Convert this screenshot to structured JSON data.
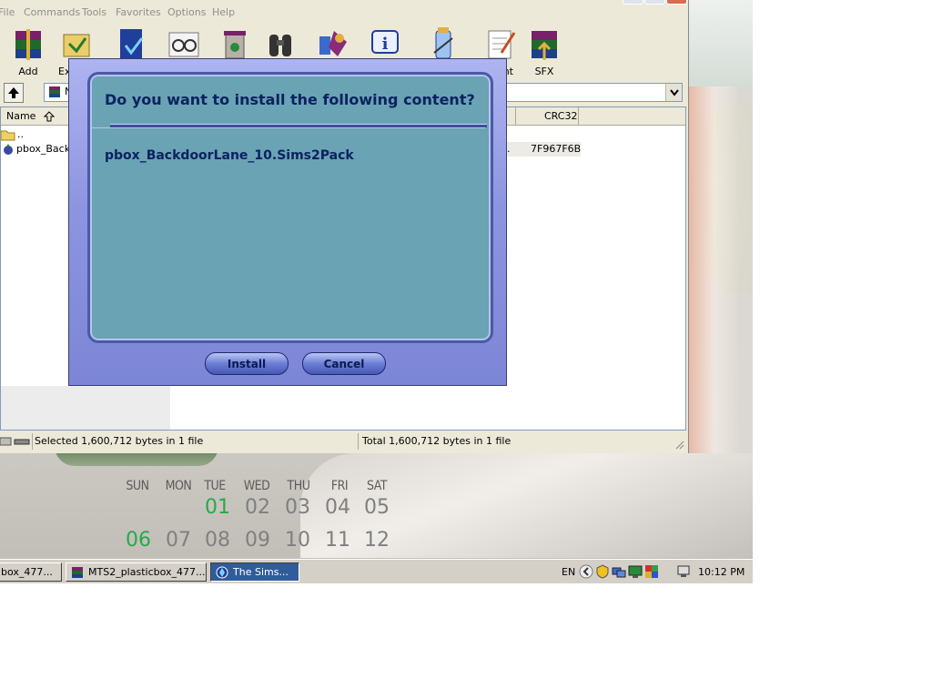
{
  "winrar": {
    "menu": [
      "File",
      "Commands",
      "Tools",
      "Favorites",
      "Options",
      "Help"
    ],
    "toolbar": [
      {
        "label": "Add",
        "icon": "archive-add-icon"
      },
      {
        "label": "Ex",
        "icon": "extract-icon"
      },
      {
        "label": "",
        "icon": "test-icon"
      },
      {
        "label": "",
        "icon": "view-icon"
      },
      {
        "label": "",
        "icon": "delete-icon"
      },
      {
        "label": "",
        "icon": "find-icon"
      },
      {
        "label": "",
        "icon": "wizard-icon"
      },
      {
        "label": "",
        "icon": "info-icon"
      },
      {
        "label": "",
        "icon": "repair-icon"
      },
      {
        "label": "nt",
        "icon": "comment-icon"
      },
      {
        "label": "SFX",
        "icon": "sfx-icon"
      }
    ],
    "address_prefix": "N",
    "columns": {
      "name": "Name",
      "crc": "CRC32"
    },
    "rows": [
      {
        "name": "..",
        "crc": ""
      },
      {
        "name": "pbox_Backd",
        "crc": "7F967F6B",
        "trail": "."
      }
    ],
    "status": {
      "selected": "Selected 1,600,712 bytes in 1 file",
      "total": "Total 1,600,712 bytes in 1 file"
    }
  },
  "dialog": {
    "title": "Do you want to install the following content?",
    "item": "pbox_BackdoorLane_10.Sims2Pack",
    "install_label": "Install",
    "cancel_label": "Cancel"
  },
  "calendar": {
    "days": [
      "SUN",
      "MON",
      "TUE",
      "WED",
      "THU",
      "FRI",
      "SAT"
    ],
    "week1": [
      "",
      "",
      "01",
      "02",
      "03",
      "04",
      "05"
    ],
    "week2": [
      "06",
      "07",
      "08",
      "09",
      "10",
      "11",
      "12"
    ],
    "highlight_color": "#2aa84a"
  },
  "taskbar": {
    "tasks": [
      {
        "label": "box_477..."
      },
      {
        "label": "MTS2_plasticbox_477..."
      },
      {
        "label": "The Sims..."
      }
    ],
    "language": "EN",
    "clock": "10:12 PM"
  }
}
